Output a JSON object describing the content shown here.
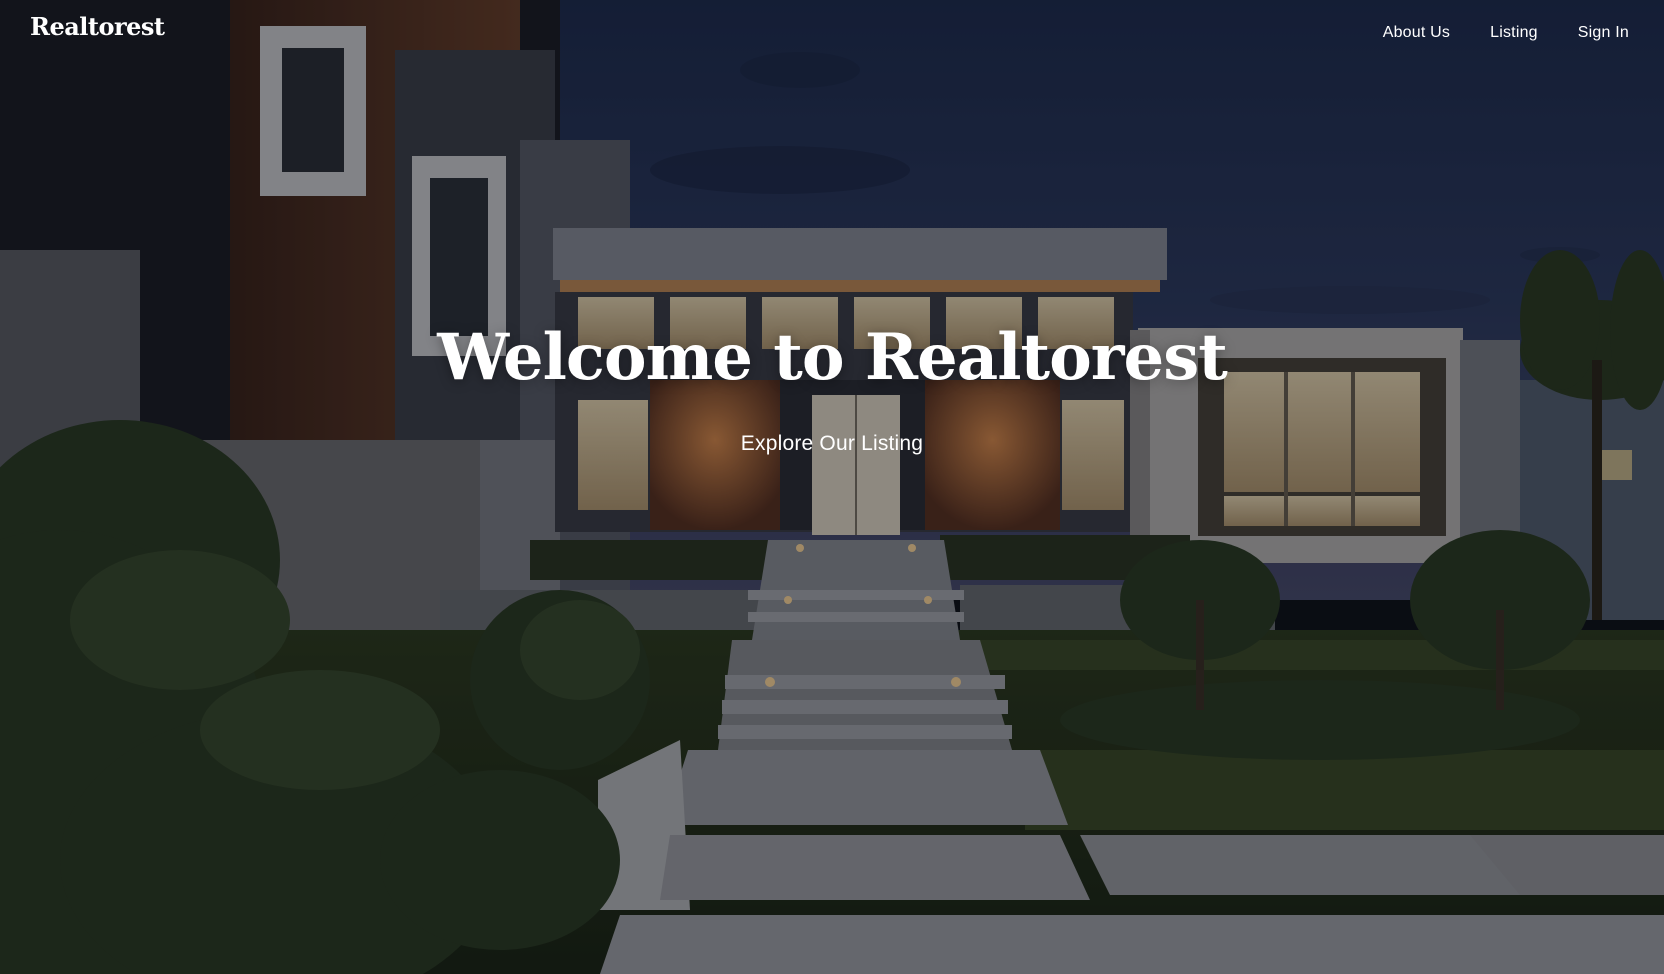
{
  "brand": {
    "name": "Realtorest"
  },
  "nav": {
    "items": [
      {
        "label": "About Us"
      },
      {
        "label": "Listing"
      },
      {
        "label": "Sign In"
      }
    ]
  },
  "hero": {
    "title": "Welcome to Realtorest",
    "cta_label": "Explore Our Listing",
    "background": "modern-house-at-dusk-photo"
  },
  "colors": {
    "text": "#ffffff",
    "overlay": "#05080f"
  }
}
